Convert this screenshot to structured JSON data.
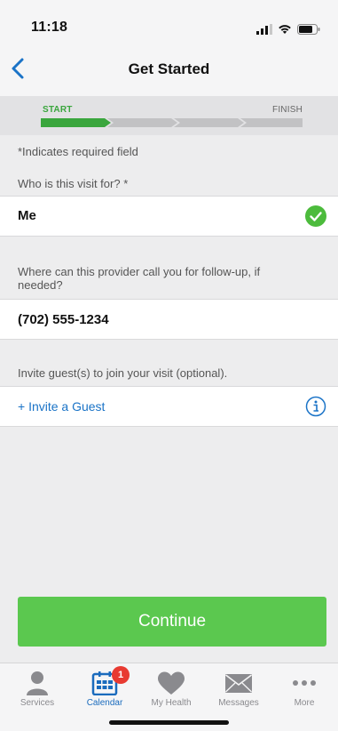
{
  "status_bar": {
    "time": "11:18"
  },
  "nav": {
    "title": "Get Started"
  },
  "progress": {
    "start_label": "START",
    "finish_label": "FINISH",
    "completed_steps": 1,
    "total_steps": 4
  },
  "form": {
    "required_note": "*Indicates required field",
    "visit_for": {
      "label": "Who is this visit for? *",
      "value": "Me"
    },
    "phone": {
      "label": "Where can this provider call you for follow-up, if needed?",
      "value": "(702) 555-1234"
    },
    "guests": {
      "label": "Invite guest(s) to join your visit (optional).",
      "link": "+ Invite a Guest"
    }
  },
  "continue_label": "Continue",
  "tabs": [
    {
      "label": "Services",
      "icon": "person-icon"
    },
    {
      "label": "Calendar",
      "icon": "calendar-icon",
      "badge": "1",
      "active": true
    },
    {
      "label": "My Health",
      "icon": "heart-icon"
    },
    {
      "label": "Messages",
      "icon": "envelope-icon"
    },
    {
      "label": "More",
      "icon": "more-dots-icon"
    }
  ],
  "colors": {
    "accent_green": "#5bc84f",
    "link_blue": "#1a73c7",
    "badge_red": "#e83a31"
  }
}
